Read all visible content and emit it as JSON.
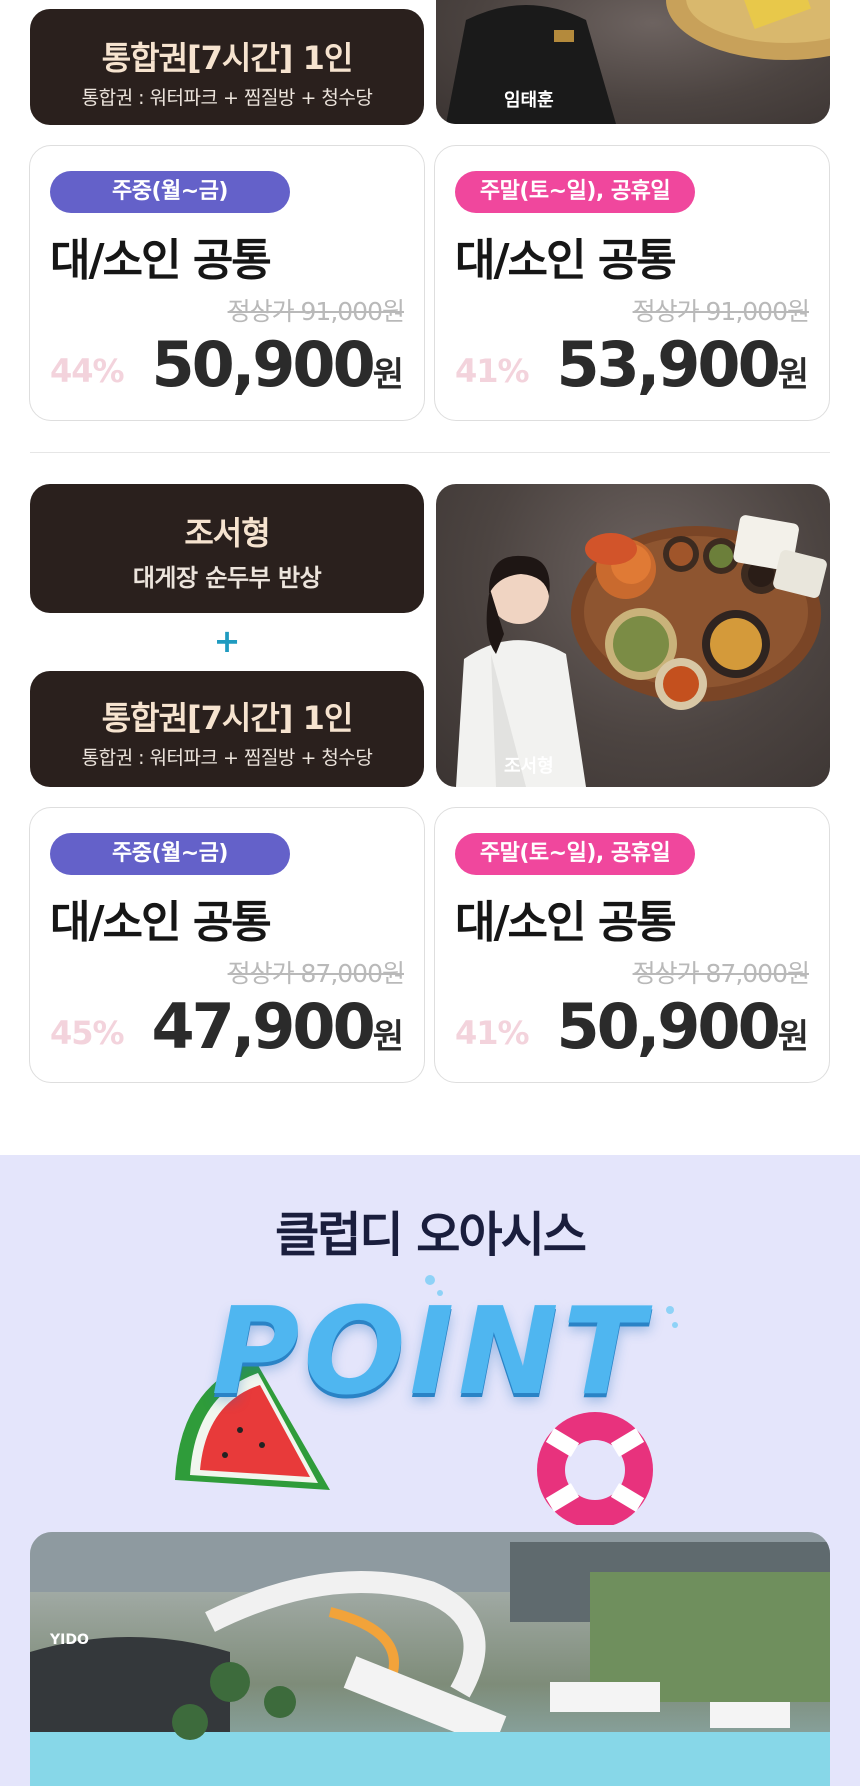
{
  "section1": {
    "package": {
      "title": "통합권[7시간] 1인",
      "subtitle": "통합권 : 워터파크 + 찜질방 + 청수당"
    },
    "chef_name": "임태훈",
    "cards": [
      {
        "pill": "주중(월~금)",
        "title": "대/소인 공통",
        "original": "정상가 91,000원",
        "discount": "44%",
        "price": "50,900",
        "won": "원"
      },
      {
        "pill": "주말(토~일), 공휴일",
        "title": "대/소인 공통",
        "original": "정상가 91,000원",
        "discount": "41%",
        "price": "53,900",
        "won": "원"
      }
    ]
  },
  "section2": {
    "dish": {
      "title": "조서형",
      "subtitle": "대게장 순두부 반상"
    },
    "plus": "+",
    "package": {
      "title": "통합권[7시간] 1인",
      "subtitle": "통합권 : 워터파크 + 찜질방 + 청수당"
    },
    "chef_name": "조서형",
    "cards": [
      {
        "pill": "주중(월~금)",
        "title": "대/소인 공통",
        "original": "정상가 87,000원",
        "discount": "45%",
        "price": "47,900",
        "won": "원"
      },
      {
        "pill": "주말(토~일), 공휴일",
        "title": "대/소인 공통",
        "original": "정상가 87,000원",
        "discount": "41%",
        "price": "50,900",
        "won": "원"
      }
    ]
  },
  "oasis": {
    "title": "클럽디 오아시스",
    "point": "POINT",
    "building_sign": "YIDO"
  },
  "colors": {
    "weekday_pill": "#6461c9",
    "weekend_pill": "#f0479d",
    "dark_box": "#2a201d",
    "oasis_bg": "#e4e5fb"
  }
}
